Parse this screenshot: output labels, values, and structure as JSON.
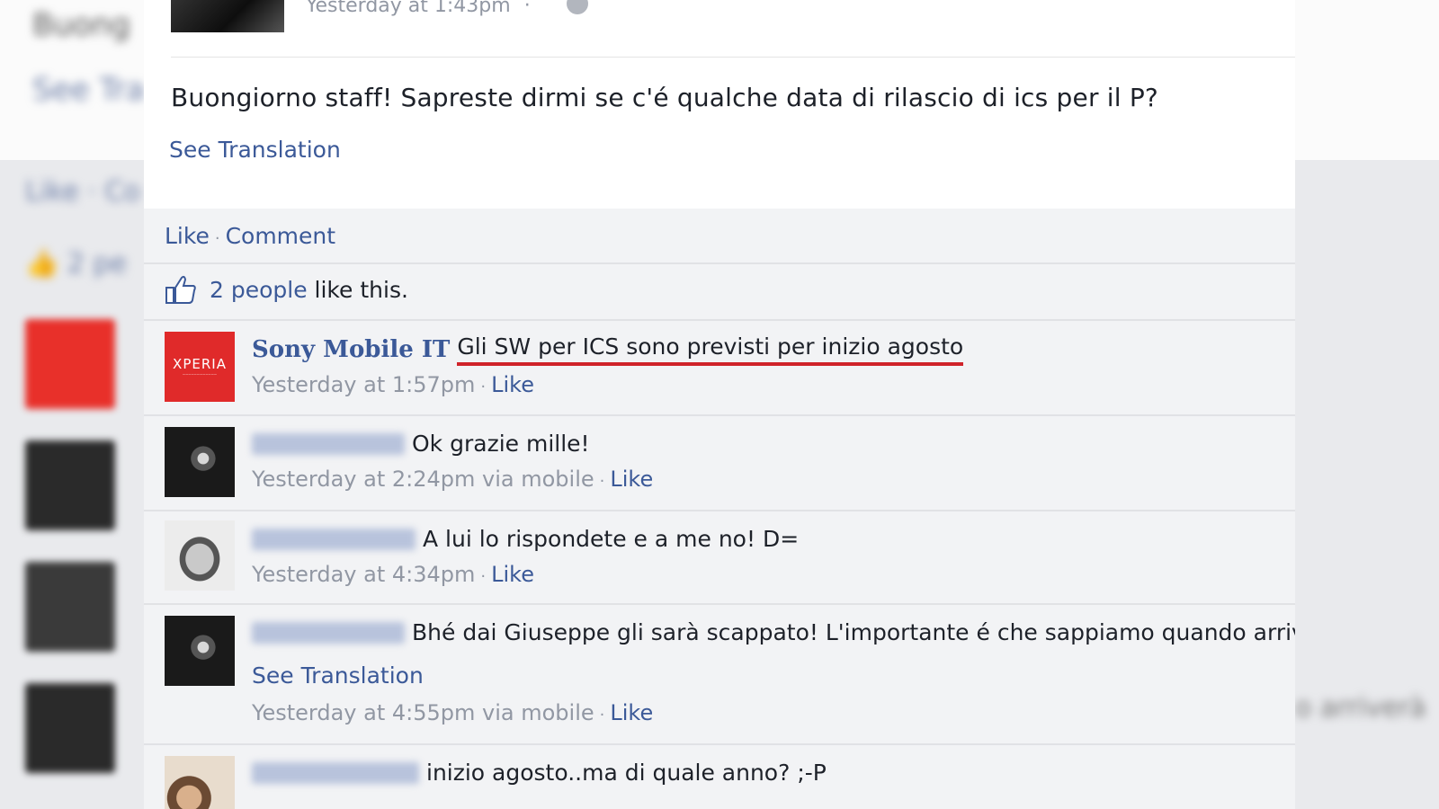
{
  "post": {
    "timestamp": "Yesterday at 1:43pm",
    "text": "Buongiorno staff! Sapreste dirmi se c'é qualche data di rilascio di ics per il P?",
    "see_translation": "See Translation",
    "actions": {
      "like": "Like",
      "comment": "Comment"
    },
    "likes": {
      "count_link": "2 people",
      "suffix": " like this."
    }
  },
  "comments": [
    {
      "author": "Sony Mobile IT",
      "text": "Gli SW per ICS sono previsti per inizio agosto",
      "time": "Yesterday at 1:57pm",
      "like": "Like",
      "avatar": "xperia-logo",
      "avatar_text": "XPERIA",
      "highlighted": true
    },
    {
      "author": "",
      "text": "Ok grazie mille!",
      "time": "Yesterday at 2:24pm via mobile",
      "like": "Like",
      "avatar": "motorcycle-photo"
    },
    {
      "author": "",
      "text": "A lui lo rispondete e a me no! D=",
      "time": "Yesterday at 4:34pm",
      "like": "Like",
      "avatar": "person-photo"
    },
    {
      "author": "",
      "text": "Bhé dai Giuseppe gli sarà scappato! L'importante é che sappiamo quando arriverà",
      "see_translation": "See Translation",
      "time": "Yesterday at 4:55pm via mobile",
      "like": "Like",
      "avatar": "motorcycle-photo"
    },
    {
      "author": "",
      "text": "inizio agosto..ma di quale anno? ;-P",
      "avatar": "couple-photo"
    }
  ],
  "colors": {
    "link": "#3b5998",
    "meta": "#9197a3",
    "highlight_underline": "#d0232a",
    "xperia_red": "#e02a2a"
  }
}
